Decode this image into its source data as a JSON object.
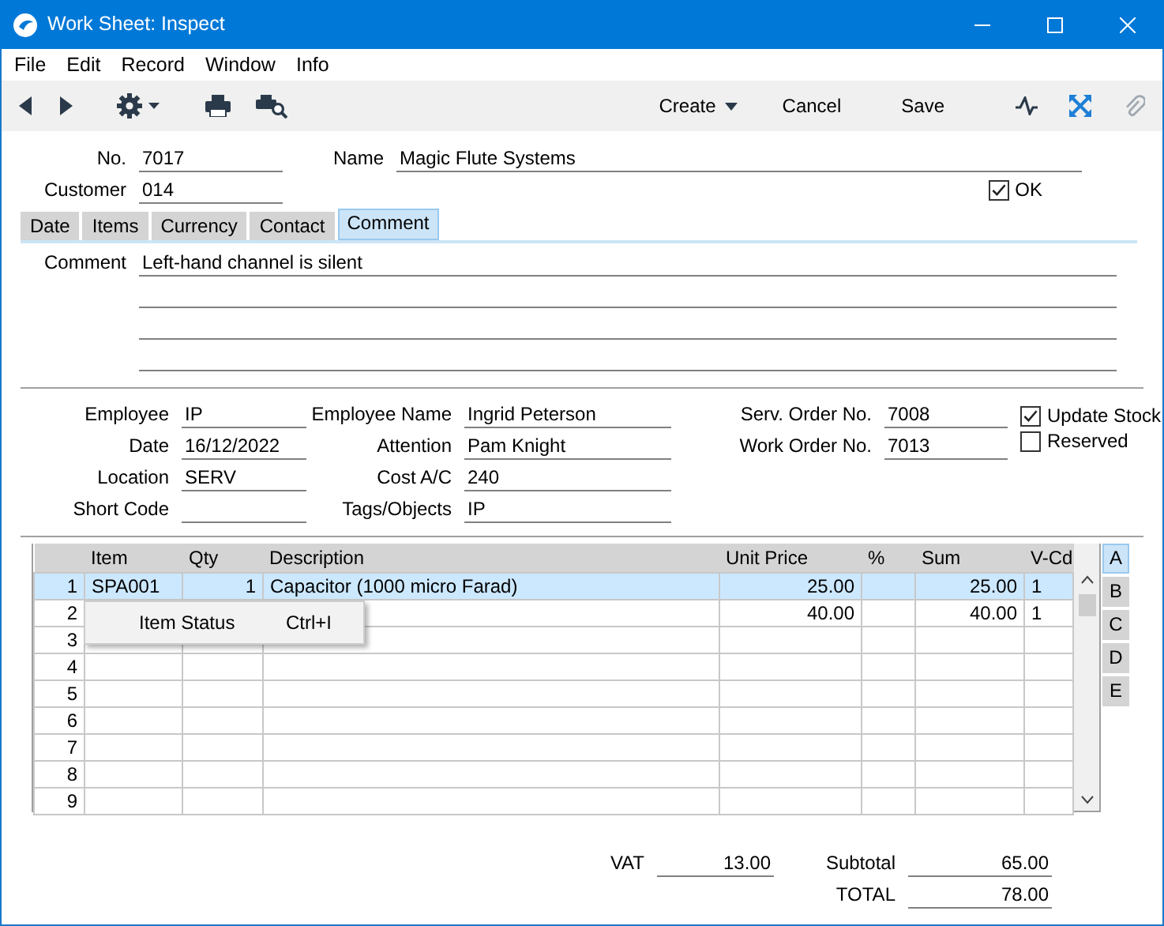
{
  "window": {
    "title": "Work Sheet: Inspect"
  },
  "menu_bar": [
    "File",
    "Edit",
    "Record",
    "Window",
    "Info"
  ],
  "toolbar": {
    "buttons": [
      {
        "label": "Create",
        "kind": "dropdown"
      },
      {
        "label": "Cancel",
        "kind": "plain"
      },
      {
        "label": "Save",
        "kind": "plain"
      }
    ]
  },
  "header": {
    "no": {
      "label": "No.",
      "value": "7017"
    },
    "customer": {
      "label": "Customer",
      "value": "014"
    },
    "name": {
      "label": "Name",
      "value": "Magic Flute Systems"
    },
    "ok": {
      "label": "OK",
      "checked": true
    }
  },
  "tabs": [
    {
      "label": "Date",
      "selected": false
    },
    {
      "label": "Items",
      "selected": false
    },
    {
      "label": "Currency",
      "selected": false
    },
    {
      "label": "Contact",
      "selected": false
    },
    {
      "label": "Comment",
      "selected": true
    }
  ],
  "comment": {
    "label": "Comment",
    "lines": [
      "Left-hand channel is silent"
    ]
  },
  "field_columns": [
    [
      {
        "label": "Employee",
        "value": "IP"
      },
      {
        "label": "Date",
        "value": "16/12/2022"
      },
      {
        "label": "Location",
        "value": "SERV"
      },
      {
        "label": "Short Code"
      }
    ],
    [
      {
        "label": "Employee Name",
        "value": "Ingrid Peterson"
      },
      {
        "label": "Attention",
        "value": "Pam Knight"
      },
      {
        "label": "Cost A/C",
        "value": "240"
      },
      {
        "label": "Tags/Objects",
        "value": "IP"
      }
    ],
    [
      {
        "label": "Serv. Order No.",
        "value": "7008"
      },
      {
        "label": "Work Order No.",
        "value": "7013"
      }
    ]
  ],
  "checkboxes": [
    {
      "label": "Update Stock",
      "checked": true
    },
    {
      "label": "Reserved",
      "checked": false
    }
  ],
  "table": {
    "columns": [
      "Item",
      "Qty",
      "Description",
      "Unit Price",
      "%",
      "Sum",
      "V-Cd"
    ],
    "rows": [
      {
        "number": "1",
        "item": "SPA001",
        "qty": "1",
        "description": "Capacitor (1000 micro Farad)",
        "unit_price": "25.00",
        "sum": "25.00",
        "v_cd": "1",
        "selected": true
      },
      {
        "number": "2",
        "unit_price": "40.00",
        "sum": "40.00",
        "v_cd": "1",
        "selected": false
      },
      {
        "number": "3",
        "selected": false
      },
      {
        "number": "4",
        "selected": false
      },
      {
        "number": "5",
        "selected": false
      },
      {
        "number": "6",
        "selected": false
      },
      {
        "number": "7",
        "selected": false
      },
      {
        "number": "8",
        "selected": false
      },
      {
        "number": "9",
        "selected": false
      }
    ]
  },
  "context_menu": {
    "items": [
      {
        "label": "Item Status",
        "shortcut": "Ctrl+I"
      }
    ]
  },
  "side_tabs": [
    {
      "label": "A",
      "selected": true
    },
    {
      "label": "B",
      "selected": false
    },
    {
      "label": "C",
      "selected": false
    },
    {
      "label": "D",
      "selected": false
    },
    {
      "label": "E",
      "selected": false
    }
  ],
  "totals": {
    "vat": {
      "label": "VAT",
      "value": "13.00"
    },
    "subtotal": {
      "label": "Subtotal",
      "value": "65.00"
    },
    "total": {
      "label": "TOTAL",
      "value": "78.00"
    }
  }
}
